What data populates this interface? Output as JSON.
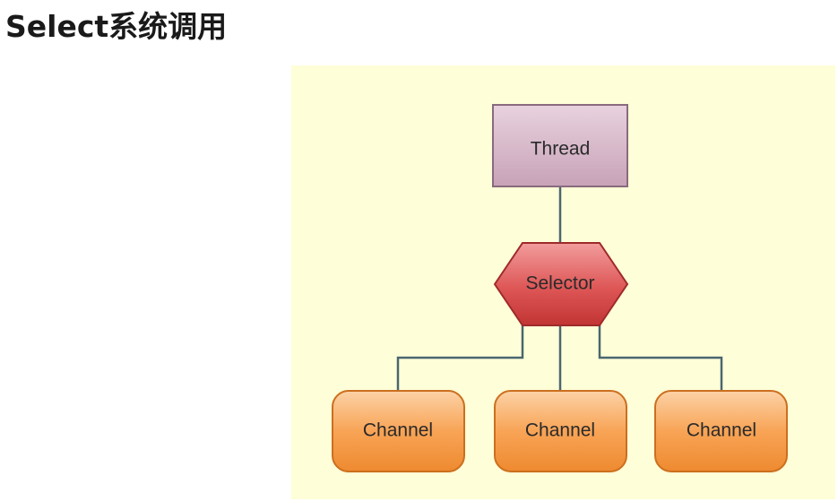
{
  "page": {
    "title": "Select系统调用"
  },
  "diagram": {
    "nodes": {
      "thread": {
        "label": "Thread"
      },
      "selector": {
        "label": "Selector"
      },
      "channels": [
        {
          "label": "Channel"
        },
        {
          "label": "Channel"
        },
        {
          "label": "Channel"
        }
      ]
    },
    "colors": {
      "background": "#fefed8",
      "thread_fill": "#d8b8cc",
      "thread_border": "#8a6a7e",
      "selector_fill": "#d94c4c",
      "selector_border": "#9e2a2a",
      "channel_fill": "#f6a050",
      "channel_border": "#cc6f1e",
      "connector": "#4a6670"
    }
  }
}
